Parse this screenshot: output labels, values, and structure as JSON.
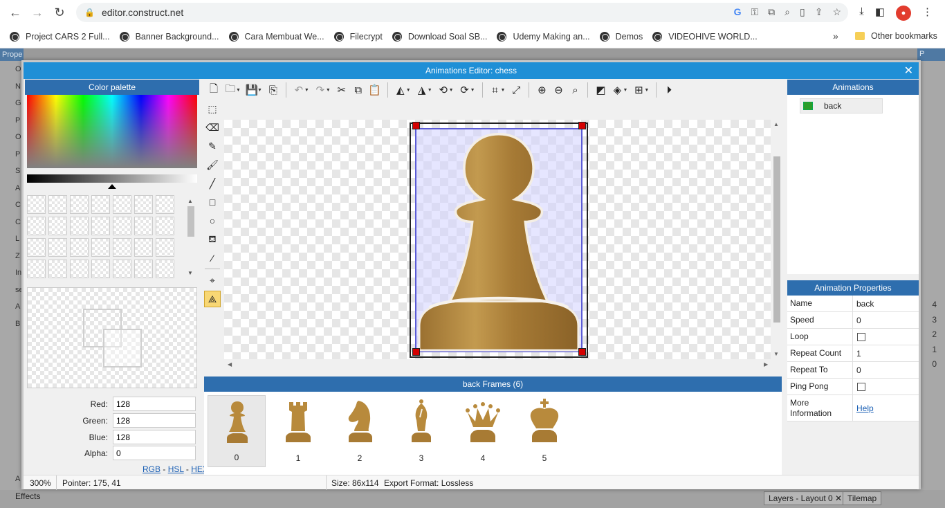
{
  "browser": {
    "url": "editor.construct.net",
    "bookmarks": [
      "Project CARS 2 Full...",
      "Banner Background...",
      "Cara Membuat We...",
      "Filecrypt",
      "Download Soal SB...",
      "Udemy Making an...",
      "Demos",
      "VIDEOHIVE WORLD..."
    ],
    "more": "»",
    "other_bookmarks": "Other bookmarks"
  },
  "background": {
    "left_panel_title": "Prope",
    "left_letters": [
      "O",
      "N",
      "G",
      "P",
      "O",
      "P",
      "S",
      "A",
      "C",
      "C",
      "L",
      "Z",
      "In",
      "se",
      "A",
      "B"
    ],
    "right_panel_title": "P",
    "right_numbers": [
      "4",
      "3",
      "2",
      "1",
      "0"
    ],
    "bottom_left_letter": "A",
    "effects_label": "Effects",
    "layers_tab": "Layers - Layout 0",
    "tilemap_tab": "Tilemap"
  },
  "dialog": {
    "title": "Animations Editor: chess",
    "close": "✕"
  },
  "color_palette": {
    "title": "Color palette",
    "fields": [
      {
        "label": "Red:",
        "value": "128"
      },
      {
        "label": "Green:",
        "value": "128"
      },
      {
        "label": "Blue:",
        "value": "128"
      },
      {
        "label": "Alpha:",
        "value": "0"
      }
    ],
    "links": {
      "rgb": "RGB",
      "hsl": "HSL",
      "hex": "HEX",
      "sep": " - "
    }
  },
  "frames": {
    "title": "back Frames (6)",
    "items": [
      {
        "num": "0",
        "piece": "pawn",
        "selected": true
      },
      {
        "num": "1",
        "piece": "rook",
        "selected": false
      },
      {
        "num": "2",
        "piece": "knight",
        "selected": false
      },
      {
        "num": "3",
        "piece": "bishop",
        "selected": false
      },
      {
        "num": "4",
        "piece": "queen",
        "selected": false
      },
      {
        "num": "5",
        "piece": "king",
        "selected": false
      }
    ]
  },
  "status": {
    "zoom": "300%",
    "pointer": "Pointer: 175, 41",
    "size": "Size: 86x114",
    "export": "Export Format: Lossless"
  },
  "animations": {
    "title": "Animations",
    "items": [
      "back"
    ]
  },
  "animation_properties": {
    "title": "Animation Properties",
    "rows": [
      {
        "key": "Name",
        "value": "back",
        "type": "text"
      },
      {
        "key": "Speed",
        "value": "0",
        "type": "text"
      },
      {
        "key": "Loop",
        "value": "",
        "type": "checkbox"
      },
      {
        "key": "Repeat Count",
        "value": "1",
        "type": "text"
      },
      {
        "key": "Repeat To",
        "value": "0",
        "type": "text"
      },
      {
        "key": "Ping Pong",
        "value": "",
        "type": "checkbox"
      },
      {
        "key": "More Information",
        "value": "Help",
        "type": "link"
      }
    ]
  },
  "colors": {
    "accent": "#2e6eae",
    "title_bar": "#1f8fd6",
    "wood": "#b88a3c",
    "handle": "#d40000",
    "selection": "#5b5bd6"
  }
}
